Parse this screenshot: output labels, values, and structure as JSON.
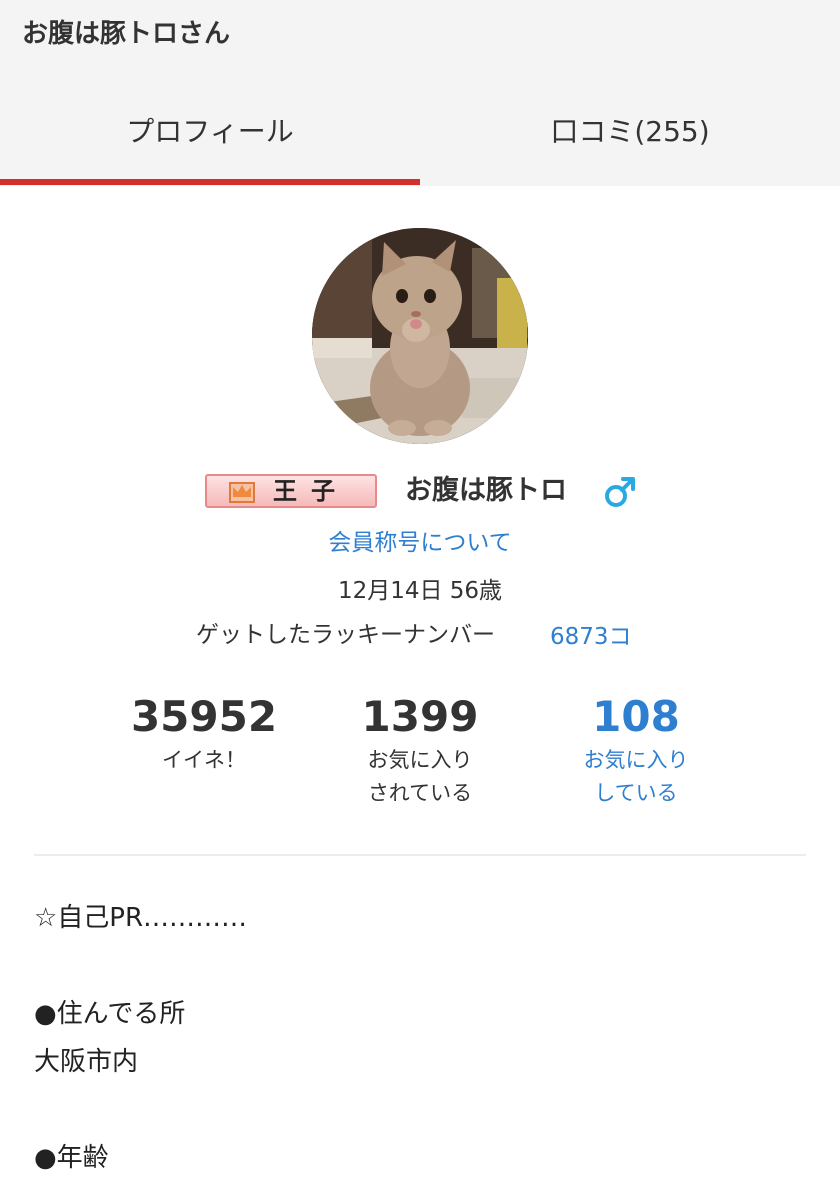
{
  "header": {
    "title": "お腹は豚トロさん"
  },
  "tabs": [
    {
      "label": "プロフィール",
      "active": true
    },
    {
      "label": "口コミ(255)",
      "active": false
    }
  ],
  "colors": {
    "accent": "#d32f2f",
    "link": "#2f7fd1",
    "text": "#333333",
    "header_bg": "#f4f4f4"
  },
  "profile": {
    "avatar_icon": "kitten-photo",
    "rank_title": "王子",
    "rank_icon": "crown-icon",
    "username": "お腹は豚トロ",
    "gender_icon": "male-icon",
    "rank_link": "会員称号について",
    "birthday": "12月14日 56歳",
    "lucky_label": "ゲットしたラッキーナンバー",
    "lucky_value": "6873コ"
  },
  "stats": {
    "likes": {
      "value": "35952",
      "label": "イイネ！"
    },
    "favorited": {
      "value": "1399",
      "label_line1": "お気に入り",
      "label_line2": "されている"
    },
    "favoriting": {
      "value": "108",
      "label_line1": "お気に入り",
      "label_line2": "している"
    }
  },
  "bio": {
    "lines": [
      "☆自己PR…………",
      "",
      "●住んでる所",
      "大阪市内",
      "",
      "●年齢"
    ]
  }
}
